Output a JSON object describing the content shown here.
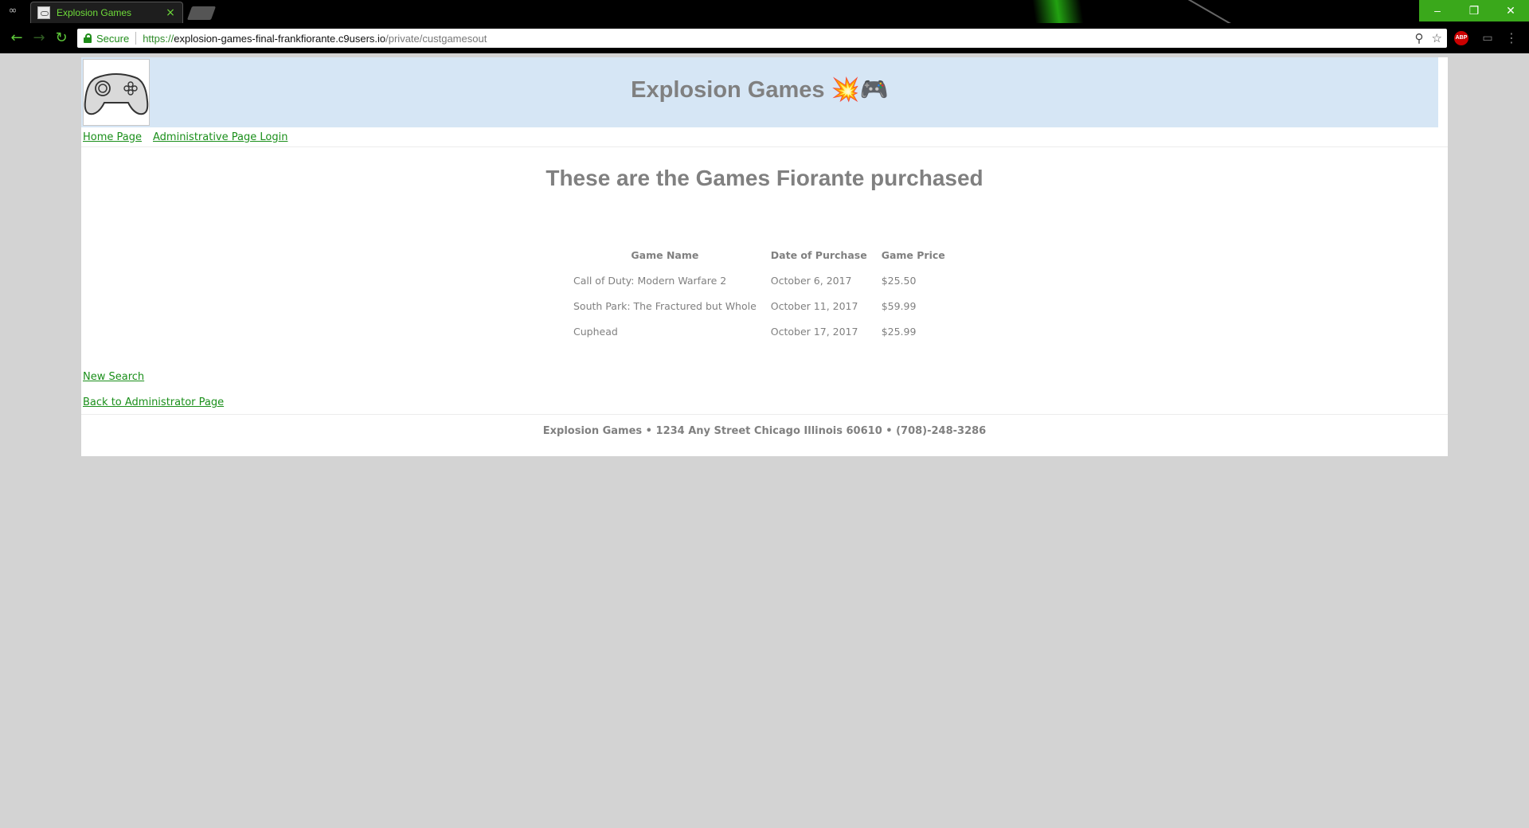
{
  "browser": {
    "tab_title": "Explosion Games",
    "tab_close": "×",
    "secure_label": "Secure",
    "url": {
      "scheme": "https://",
      "host": "explosion-games-final-frankfiorante.c9users.io",
      "path": "/private/custgamesout"
    },
    "window_controls": {
      "minimize": "–",
      "maximize": "❐",
      "close": "✕"
    },
    "nav_icons": {
      "back": "←",
      "forward": "→",
      "reload": "↻"
    },
    "omnibox_icons": {
      "zoom": "⚲",
      "bookmark": "☆"
    },
    "extensions": {
      "abp": "ABP",
      "cast": "▭",
      "menu": "⋮"
    },
    "accent_color": "#3aa81b"
  },
  "site": {
    "title": "Explosion Games 💥🎮",
    "header_bg": "#d6e6f5",
    "text_color": "#808080",
    "link_color": "#1a8f1a"
  },
  "nav": {
    "home": "Home Page",
    "admin_login": "Administrative Page Login"
  },
  "main": {
    "heading": "These are the Games Fiorante purchased",
    "table": {
      "headers": [
        "Game Name",
        "Date of Purchase",
        "Game Price"
      ],
      "rows": [
        [
          "Call of Duty: Modern Warfare 2",
          "October 6, 2017",
          "$25.50"
        ],
        [
          "South Park: The Fractured but Whole",
          "October 11, 2017",
          "$59.99"
        ],
        [
          "Cuphead",
          "October 17, 2017",
          "$25.99"
        ]
      ]
    },
    "new_search": "New Search",
    "back_admin": "Back to Administrator Page"
  },
  "footer": {
    "text": "Explosion Games • 1234 Any Street Chicago Illinois 60610 • (708)-248-3286"
  }
}
